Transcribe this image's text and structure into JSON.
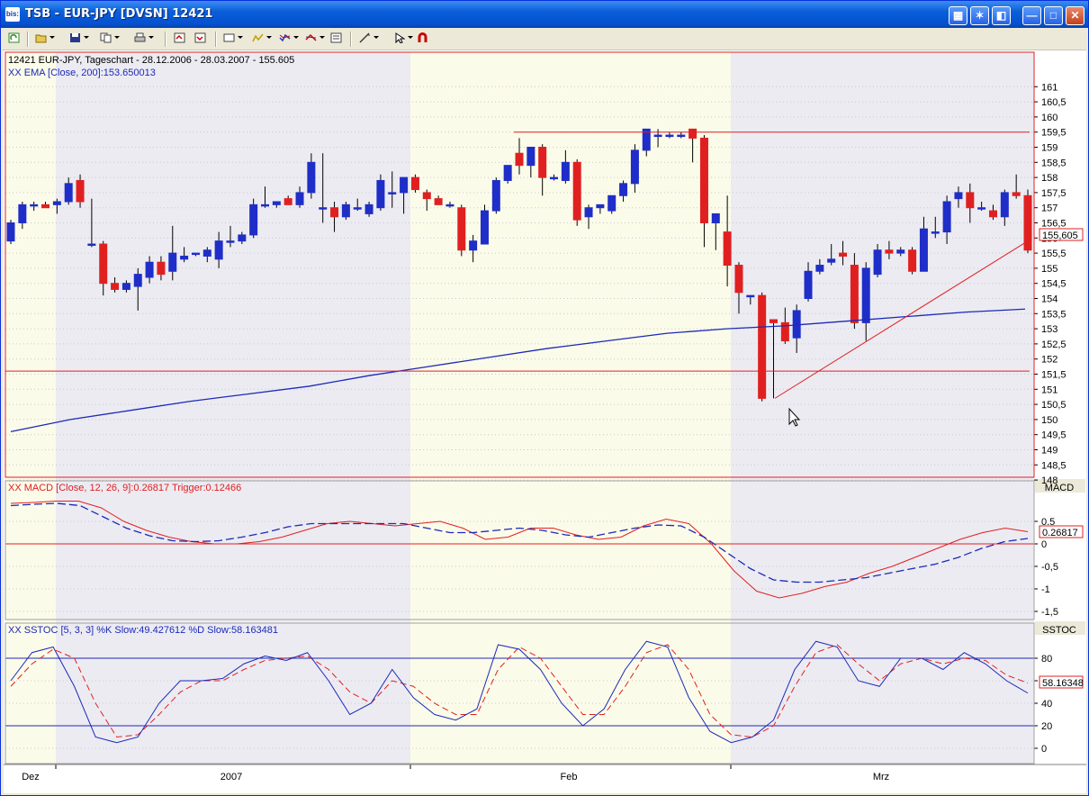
{
  "window": {
    "title": "TSB - EUR-JPY [DVSN] 12421",
    "app_icon": "bis:"
  },
  "toolbar_icons": [
    "refresh-icon",
    "open-folder-icon",
    "save-icon",
    "copy-icon",
    "print-icon",
    "undo-icon",
    "redo-icon",
    "chart-style-icon",
    "indicator-icon",
    "indicator2-icon",
    "indicator3-icon",
    "properties-icon",
    "draw-line-icon",
    "cursor-icon",
    "magnet-icon"
  ],
  "colors": {
    "bull": "#1f2ec8",
    "bear": "#e02020",
    "ema": "#1c2ab8",
    "red_line": "#e02020",
    "band_grey": "#ecebf2",
    "band_yellow": "#fbfbe9",
    "title_blue": "#0a5fd8"
  },
  "price_panel": {
    "header": "12421  EUR-JPY, Tageschart - 28.12.2006 - 28.03.2007 - 155.605",
    "ema_label": "XX EMA [Close, 200]:153.650013",
    "current_price_label": "155,605",
    "y_ticks": [
      "161",
      "160,5",
      "160",
      "159,5",
      "159",
      "158,5",
      "158",
      "157,5",
      "157",
      "156,5",
      "156",
      "155,5",
      "155",
      "154,5",
      "154",
      "153,5",
      "153",
      "152,5",
      "152",
      "151,5",
      "151",
      "150,5",
      "150",
      "149,5",
      "149",
      "148,5",
      "148"
    ]
  },
  "macd_panel": {
    "header": "XX MACD [Close, 12, 26, 9]:0.26817 Trigger:0.12466",
    "name": "MACD",
    "value_label": "0.26817",
    "y_ticks": [
      "0.5",
      "0",
      "-0,5",
      "-1",
      "-1,5"
    ]
  },
  "sstoc_panel": {
    "header": "XX SSTOC [5, 3, 3] %K Slow:49.427612 %D Slow:58.163481",
    "name": "SSTOC",
    "value_label": "58.16348",
    "y_ticks": [
      "80",
      "60",
      "40",
      "20",
      "0"
    ]
  },
  "x_axis": {
    "labels": [
      "Dez",
      "2007",
      "Feb",
      "Mrz"
    ]
  },
  "chart_data": {
    "type": "candlestick",
    "candles": [
      {
        "o": 155.9,
        "h": 156.6,
        "l": 155.8,
        "c": 156.5
      },
      {
        "o": 156.5,
        "h": 157.2,
        "l": 156.3,
        "c": 157.1
      },
      {
        "o": 157.1,
        "h": 157.2,
        "l": 156.9,
        "c": 157.1
      },
      {
        "o": 157.1,
        "h": 157.2,
        "l": 157.0,
        "c": 157.0
      },
      {
        "o": 157.1,
        "h": 157.3,
        "l": 156.8,
        "c": 157.2
      },
      {
        "o": 157.2,
        "h": 158.0,
        "l": 157.1,
        "c": 157.8
      },
      {
        "o": 157.9,
        "h": 158.1,
        "l": 157.0,
        "c": 157.2
      },
      {
        "o": 155.8,
        "h": 157.3,
        "l": 155.7,
        "c": 155.8
      },
      {
        "o": 155.8,
        "h": 155.9,
        "l": 154.1,
        "c": 154.5
      },
      {
        "o": 154.5,
        "h": 154.7,
        "l": 154.2,
        "c": 154.3
      },
      {
        "o": 154.3,
        "h": 154.6,
        "l": 154.2,
        "c": 154.5
      },
      {
        "o": 154.4,
        "h": 155.0,
        "l": 153.6,
        "c": 154.8
      },
      {
        "o": 154.7,
        "h": 155.4,
        "l": 154.5,
        "c": 155.2
      },
      {
        "o": 155.2,
        "h": 155.4,
        "l": 154.6,
        "c": 154.8
      },
      {
        "o": 154.9,
        "h": 156.4,
        "l": 154.6,
        "c": 155.5
      },
      {
        "o": 155.3,
        "h": 155.7,
        "l": 155.2,
        "c": 155.4
      },
      {
        "o": 155.5,
        "h": 155.5,
        "l": 155.4,
        "c": 155.5
      },
      {
        "o": 155.4,
        "h": 155.7,
        "l": 155.2,
        "c": 155.6
      },
      {
        "o": 155.3,
        "h": 156.2,
        "l": 155.0,
        "c": 155.9
      },
      {
        "o": 155.9,
        "h": 156.4,
        "l": 155.7,
        "c": 155.9
      },
      {
        "o": 155.9,
        "h": 156.2,
        "l": 155.8,
        "c": 156.1
      },
      {
        "o": 156.1,
        "h": 157.3,
        "l": 156.0,
        "c": 157.1
      },
      {
        "o": 157.1,
        "h": 157.7,
        "l": 157.0,
        "c": 157.1
      },
      {
        "o": 157.1,
        "h": 157.2,
        "l": 157.0,
        "c": 157.2
      },
      {
        "o": 157.3,
        "h": 157.4,
        "l": 157.1,
        "c": 157.1
      },
      {
        "o": 157.1,
        "h": 157.7,
        "l": 157.0,
        "c": 157.5
      },
      {
        "o": 157.5,
        "h": 158.8,
        "l": 157.3,
        "c": 158.5
      },
      {
        "o": 157.0,
        "h": 158.8,
        "l": 156.5,
        "c": 157.0
      },
      {
        "o": 157.0,
        "h": 157.2,
        "l": 156.2,
        "c": 156.7
      },
      {
        "o": 156.7,
        "h": 157.2,
        "l": 156.6,
        "c": 157.1
      },
      {
        "o": 157.0,
        "h": 157.3,
        "l": 156.9,
        "c": 157.0
      },
      {
        "o": 156.8,
        "h": 157.2,
        "l": 156.7,
        "c": 157.1
      },
      {
        "o": 157.0,
        "h": 158.1,
        "l": 156.9,
        "c": 157.9
      },
      {
        "o": 157.5,
        "h": 158.2,
        "l": 157.0,
        "c": 157.5
      },
      {
        "o": 157.5,
        "h": 158.0,
        "l": 156.8,
        "c": 158.0
      },
      {
        "o": 158.0,
        "h": 158.1,
        "l": 157.5,
        "c": 157.6
      },
      {
        "o": 157.5,
        "h": 157.6,
        "l": 156.9,
        "c": 157.3
      },
      {
        "o": 157.3,
        "h": 157.4,
        "l": 157.1,
        "c": 157.1
      },
      {
        "o": 157.1,
        "h": 157.2,
        "l": 157.0,
        "c": 157.1
      },
      {
        "o": 157.0,
        "h": 157.1,
        "l": 155.4,
        "c": 155.6
      },
      {
        "o": 155.6,
        "h": 156.1,
        "l": 155.2,
        "c": 155.9
      },
      {
        "o": 155.8,
        "h": 157.1,
        "l": 155.8,
        "c": 156.9
      },
      {
        "o": 156.9,
        "h": 158.0,
        "l": 156.8,
        "c": 157.9
      },
      {
        "o": 157.9,
        "h": 158.4,
        "l": 157.8,
        "c": 158.4
      },
      {
        "o": 158.8,
        "h": 159.3,
        "l": 158.1,
        "c": 158.4
      },
      {
        "o": 158.4,
        "h": 159.0,
        "l": 158.0,
        "c": 159.0
      },
      {
        "o": 159.0,
        "h": 159.1,
        "l": 157.4,
        "c": 158.0
      },
      {
        "o": 158.0,
        "h": 158.1,
        "l": 157.9,
        "c": 158.0
      },
      {
        "o": 157.9,
        "h": 158.9,
        "l": 157.8,
        "c": 158.5
      },
      {
        "o": 158.5,
        "h": 158.6,
        "l": 156.4,
        "c": 156.6
      },
      {
        "o": 156.7,
        "h": 157.1,
        "l": 156.3,
        "c": 157.0
      },
      {
        "o": 157.0,
        "h": 157.1,
        "l": 156.8,
        "c": 157.1
      },
      {
        "o": 156.9,
        "h": 157.4,
        "l": 156.8,
        "c": 157.4
      },
      {
        "o": 157.4,
        "h": 157.9,
        "l": 157.2,
        "c": 157.8
      },
      {
        "o": 157.8,
        "h": 159.1,
        "l": 157.5,
        "c": 158.9
      },
      {
        "o": 158.9,
        "h": 159.6,
        "l": 158.7,
        "c": 159.6
      },
      {
        "o": 159.4,
        "h": 159.6,
        "l": 159.0,
        "c": 159.4
      },
      {
        "o": 159.4,
        "h": 159.5,
        "l": 159.3,
        "c": 159.4
      },
      {
        "o": 159.4,
        "h": 159.5,
        "l": 159.3,
        "c": 159.4
      },
      {
        "o": 159.6,
        "h": 159.6,
        "l": 158.5,
        "c": 159.3
      },
      {
        "o": 159.3,
        "h": 159.4,
        "l": 155.7,
        "c": 156.5
      },
      {
        "o": 156.5,
        "h": 156.8,
        "l": 155.6,
        "c": 156.8
      },
      {
        "o": 156.2,
        "h": 157.4,
        "l": 154.4,
        "c": 155.1
      },
      {
        "o": 155.1,
        "h": 155.2,
        "l": 153.5,
        "c": 154.2
      },
      {
        "o": 154.1,
        "h": 154.1,
        "l": 153.8,
        "c": 154.1
      },
      {
        "o": 154.1,
        "h": 154.2,
        "l": 150.6,
        "c": 150.7
      },
      {
        "o": 153.3,
        "h": 153.3,
        "l": 150.7,
        "c": 153.2
      },
      {
        "o": 153.2,
        "h": 153.7,
        "l": 152.5,
        "c": 152.6
      },
      {
        "o": 152.7,
        "h": 153.8,
        "l": 152.2,
        "c": 153.6
      },
      {
        "o": 154.0,
        "h": 155.2,
        "l": 153.9,
        "c": 154.9
      },
      {
        "o": 154.9,
        "h": 155.3,
        "l": 154.8,
        "c": 155.1
      },
      {
        "o": 155.2,
        "h": 155.8,
        "l": 155.1,
        "c": 155.3
      },
      {
        "o": 155.5,
        "h": 155.9,
        "l": 155.1,
        "c": 155.4
      },
      {
        "o": 155.1,
        "h": 155.5,
        "l": 153.0,
        "c": 153.2
      },
      {
        "o": 153.2,
        "h": 155.2,
        "l": 152.6,
        "c": 155.0
      },
      {
        "o": 154.8,
        "h": 155.8,
        "l": 154.7,
        "c": 155.6
      },
      {
        "o": 155.6,
        "h": 155.9,
        "l": 155.3,
        "c": 155.5
      },
      {
        "o": 155.5,
        "h": 155.7,
        "l": 155.4,
        "c": 155.6
      },
      {
        "o": 155.6,
        "h": 155.7,
        "l": 154.8,
        "c": 154.9
      },
      {
        "o": 154.9,
        "h": 156.7,
        "l": 154.9,
        "c": 156.3
      },
      {
        "o": 156.2,
        "h": 156.7,
        "l": 156.0,
        "c": 156.2
      },
      {
        "o": 156.2,
        "h": 157.4,
        "l": 155.8,
        "c": 157.2
      },
      {
        "o": 157.3,
        "h": 157.7,
        "l": 157.0,
        "c": 157.5
      },
      {
        "o": 157.5,
        "h": 157.8,
        "l": 156.5,
        "c": 157.0
      },
      {
        "o": 157.0,
        "h": 157.2,
        "l": 156.9,
        "c": 157.0
      },
      {
        "o": 156.9,
        "h": 157.1,
        "l": 156.6,
        "c": 156.7
      },
      {
        "o": 156.7,
        "h": 157.6,
        "l": 156.4,
        "c": 157.5
      },
      {
        "o": 157.5,
        "h": 158.1,
        "l": 157.3,
        "c": 157.4
      },
      {
        "o": 157.4,
        "h": 157.6,
        "l": 155.5,
        "c": 155.6
      }
    ],
    "ema": [
      149.6,
      150.0,
      150.3,
      150.6,
      150.85,
      151.1,
      151.45,
      151.75,
      152.05,
      152.35,
      152.6,
      152.85,
      153.0,
      153.1,
      153.25,
      153.4,
      153.55,
      153.65
    ],
    "resistance": 159.5,
    "support": 151.6,
    "trend_from": 150.7,
    "trend_to": 155.9,
    "macd": [
      0.9,
      0.92,
      0.95,
      0.95,
      0.8,
      0.5,
      0.3,
      0.15,
      0.05,
      0.0,
      0.0,
      0.05,
      0.15,
      0.3,
      0.45,
      0.5,
      0.45,
      0.4,
      0.45,
      0.5,
      0.35,
      0.1,
      0.15,
      0.35,
      0.35,
      0.2,
      0.1,
      0.15,
      0.4,
      0.55,
      0.45,
      0.0,
      -0.6,
      -1.05,
      -1.2,
      -1.1,
      -0.95,
      -0.85,
      -0.65,
      -0.5,
      -0.3,
      -0.1,
      0.1,
      0.25,
      0.35,
      0.27
    ],
    "trigger": [
      0.85,
      0.88,
      0.9,
      0.85,
      0.6,
      0.35,
      0.18,
      0.07,
      0.05,
      0.07,
      0.15,
      0.25,
      0.38,
      0.45,
      0.45,
      0.45,
      0.45,
      0.45,
      0.35,
      0.25,
      0.25,
      0.3,
      0.35,
      0.3,
      0.2,
      0.15,
      0.25,
      0.35,
      0.42,
      0.4,
      0.15,
      -0.2,
      -0.55,
      -0.8,
      -0.85,
      -0.85,
      -0.8,
      -0.75,
      -0.65,
      -0.55,
      -0.45,
      -0.3,
      -0.1,
      0.05,
      0.12
    ],
    "k_slow": [
      60,
      85,
      90,
      55,
      10,
      5,
      10,
      40,
      60,
      60,
      62,
      75,
      82,
      78,
      85,
      60,
      30,
      40,
      70,
      45,
      30,
      25,
      35,
      92,
      88,
      70,
      40,
      20,
      35,
      70,
      95,
      90,
      45,
      15,
      5,
      10,
      25,
      70,
      95,
      90,
      60,
      55,
      80,
      80,
      70,
      85,
      75,
      60,
      49
    ],
    "d_slow": [
      55,
      75,
      88,
      80,
      40,
      10,
      12,
      30,
      50,
      60,
      60,
      70,
      78,
      80,
      82,
      70,
      50,
      40,
      60,
      55,
      40,
      30,
      30,
      70,
      90,
      80,
      55,
      30,
      30,
      55,
      85,
      92,
      70,
      30,
      12,
      10,
      20,
      55,
      85,
      92,
      75,
      60,
      75,
      80,
      75,
      80,
      78,
      65,
      58
    ]
  }
}
